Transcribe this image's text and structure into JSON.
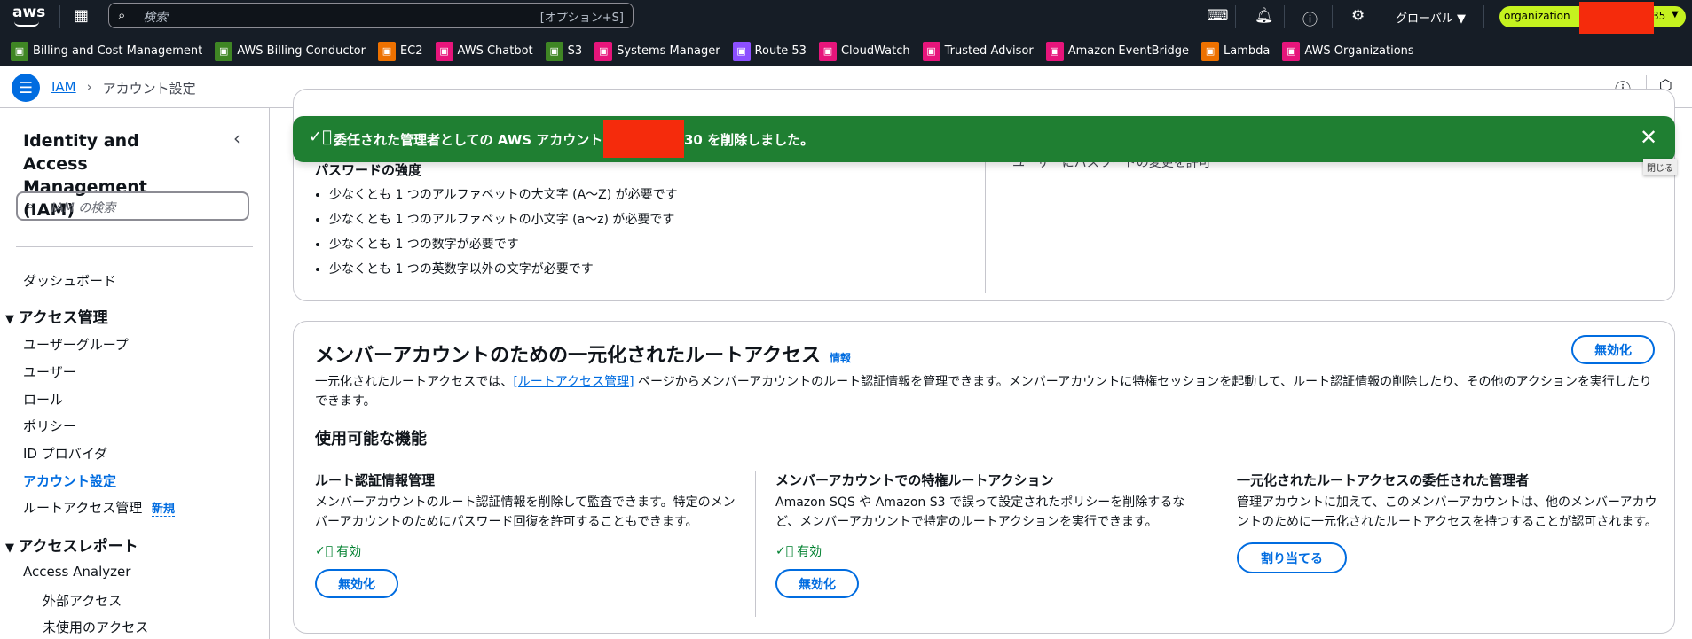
{
  "topbar": {
    "logo": "aws",
    "search_placeholder": "検索",
    "search_shortcut": "[オプション+S]",
    "region": "グローバル ▼",
    "account": "organization",
    "account_suffix": "35"
  },
  "bookmarks": [
    {
      "label": "Billing and Cost Management",
      "color": "#3f8624"
    },
    {
      "label": "AWS Billing Conductor",
      "color": "#3f8624"
    },
    {
      "label": "EC2",
      "color": "#ed7100"
    },
    {
      "label": "AWS Chatbot",
      "color": "#e7157b"
    },
    {
      "label": "S3",
      "color": "#3f8624"
    },
    {
      "label": "Systems Manager",
      "color": "#e7157b"
    },
    {
      "label": "Route 53",
      "color": "#8c4fff"
    },
    {
      "label": "CloudWatch",
      "color": "#e7157b"
    },
    {
      "label": "Trusted Advisor",
      "color": "#e7157b"
    },
    {
      "label": "Amazon EventBridge",
      "color": "#e7157b"
    },
    {
      "label": "Lambda",
      "color": "#ed7100"
    },
    {
      "label": "AWS Organizations",
      "color": "#e7157b"
    }
  ],
  "breadcrumb": {
    "root": "IAM",
    "current": "アカウント設定"
  },
  "sidebar": {
    "title": "Identity and Access Management (IAM)",
    "search_placeholder": "IAM の検索",
    "dashboard": "ダッシュボード",
    "access_mgmt": "アクセス管理",
    "items": [
      "ユーザーグループ",
      "ユーザー",
      "ロール",
      "ポリシー",
      "ID プロバイダ",
      "アカウント設定",
      "ルートアクセス管理"
    ],
    "new_badge": "新規",
    "access_reports": "アクセスレポート",
    "analyzer": "Access Analyzer",
    "external": "外部アクセス",
    "unused": "未使用のアクセス"
  },
  "flash": {
    "message_prefix": "委任された管理者としての AWS アカウント",
    "message_suffix": "30 を削除しました。",
    "close_tooltip": "閉じる",
    "color": "#1f7f32"
  },
  "password_card": {
    "heading": "パスワードの強度",
    "rules": [
      "少なくとも 1 つのアルファベットの大文字 (A〜Z) が必要です",
      "少なくとも 1 つのアルファベットの小文字 (a〜z) が必要です",
      "少なくとも 1 つの数字が必要です",
      "少なくとも 1 つの英数字以外の文字が必要です"
    ],
    "right_item": "ユーザーにパスワードの変更を許可"
  },
  "root_card": {
    "title": "メンバーアカウントのための一元化されたルートアクセス",
    "info": "情報",
    "disable": "無効化",
    "desc_prefix": "一元化されたルートアクセスでは、",
    "desc_link": "[ルートアクセス管理]",
    "desc_suffix": " ページからメンバーアカウントのルート認証情報を管理できます。メンバーアカウントに特権セッションを起動して、ルート認証情報の削除したり、その他のアクションを実行したりできます。",
    "features_heading": "使用可能な機能",
    "features": [
      {
        "title": "ルート認証情報管理",
        "desc": "メンバーアカウントのルート認証情報を削除して監査できます。特定のメンバーアカウントのためにパスワード回復を許可することもできます。",
        "status": "有効",
        "button": "無効化"
      },
      {
        "title": "メンバーアカウントでの特権ルートアクション",
        "desc": "Amazon SQS や Amazon S3 で誤って設定されたポリシーを削除するなど、メンバーアカウントで特定のルートアクションを実行できます。",
        "status": "有効",
        "button": "無効化"
      },
      {
        "title": "一元化されたルートアクセスの委任された管理者",
        "desc": "管理アカウントに加えて、このメンバーアカウントは、他のメンバーアカウントのために一元化されたルートアクセスを持つすることが認可されます。",
        "button": "割り当てる"
      }
    ]
  }
}
